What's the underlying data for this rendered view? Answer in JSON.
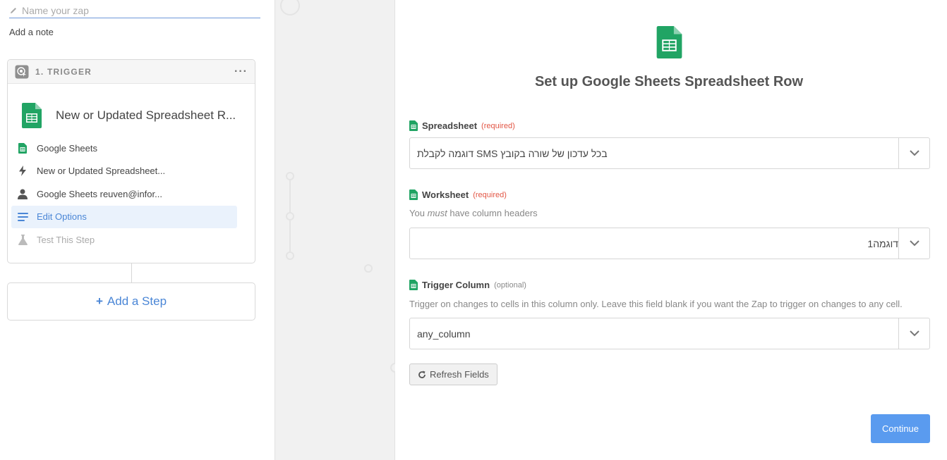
{
  "left": {
    "zap_name_placeholder": "Name your zap",
    "add_note": "Add a note",
    "trigger_label": "1. TRIGGER",
    "more_label": "···",
    "trigger_title": "New or Updated Spreadsheet R...",
    "menu": [
      {
        "label": "Google Sheets",
        "icon": "sheets-icon"
      },
      {
        "label": "New or Updated Spreadsheet...",
        "icon": "bolt-icon"
      },
      {
        "label": "Google Sheets reuven@infor...",
        "icon": "user-icon"
      },
      {
        "label": "Edit Options",
        "icon": "list-icon",
        "active": true
      },
      {
        "label": "Test This Step",
        "icon": "flask-icon",
        "disabled": true
      }
    ],
    "add_step_plus": "+",
    "add_step": "Add a Step"
  },
  "right": {
    "title": "Set up Google Sheets Spreadsheet Row",
    "fields": [
      {
        "label": "Spreadsheet",
        "tag": "(required)",
        "value": "בכל עדכון של שורה בקובץ SMS דוגמה לקבלת"
      },
      {
        "label": "Worksheet",
        "tag": "(required)",
        "help_pre": "You ",
        "help_em": "must",
        "help_post": " have column headers",
        "value": "דוגמה1"
      },
      {
        "label": "Trigger Column",
        "tag": "(optional)",
        "help": "Trigger on changes to cells in this column only. Leave this field blank if you want the Zap to trigger on changes to any cell.",
        "value": "any_column"
      }
    ],
    "refresh": "Refresh Fields",
    "continue": "Continue"
  },
  "colors": {
    "accent": "#4a86d6",
    "sheets_green": "#21a464",
    "button_blue": "#5a9bef",
    "required_red": "#e25544"
  }
}
